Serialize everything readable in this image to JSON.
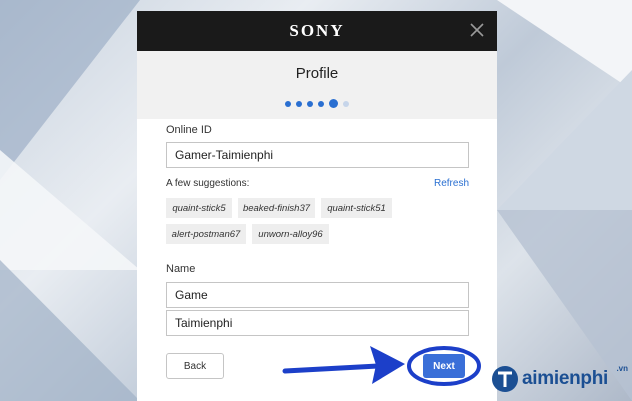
{
  "window": {
    "brand": "SONY"
  },
  "profile": {
    "title": "Profile",
    "steps_total": 6,
    "steps_current": 5
  },
  "online_id": {
    "label": "Online ID",
    "value": "Gamer-Taimienphi"
  },
  "suggestions": {
    "label": "A few suggestions:",
    "refresh": "Refresh",
    "items": [
      "quaint-stick5",
      "beaked-finish37",
      "quaint-stick51",
      "alert-postman67",
      "unworn-alloy96"
    ]
  },
  "name": {
    "label": "Name",
    "first": "Game",
    "last": "Taimienphi"
  },
  "buttons": {
    "back": "Back",
    "next": "Next"
  },
  "watermark": {
    "text": "aimienphi",
    "suffix": ".vn"
  },
  "colors": {
    "accent": "#2a6fd1",
    "next_button": "#3a6fd8",
    "annotation": "#1c3fc9"
  }
}
